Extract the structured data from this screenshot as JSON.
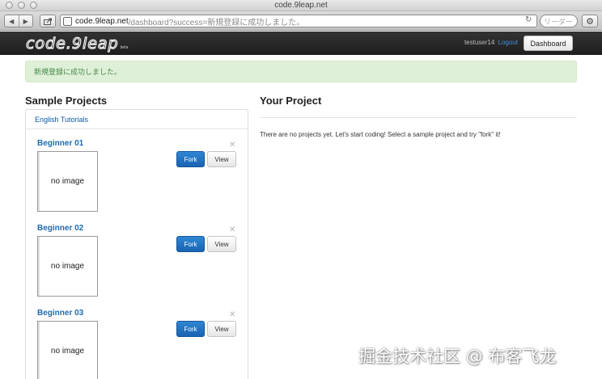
{
  "window": {
    "title": "code.9leap.net"
  },
  "toolbar": {
    "back_icon": "back-arrow-icon",
    "forward_icon": "forward-arrow-icon",
    "url_host": "code.9leap.net",
    "url_path": "/dashboard?success=新規登録に成功しました。",
    "search_placeholder": "リーダー"
  },
  "navbar": {
    "logo": "code.9leap",
    "logo_beta": "beta",
    "username": "testuser14",
    "logout_label": "Logout",
    "dashboard_label": "Dashboard"
  },
  "alert": {
    "message": "新規登録に成功しました。"
  },
  "sample": {
    "heading": "Sample Projects",
    "tab_label": "English Tutorials",
    "projects": [
      {
        "title": "Beginner 01",
        "thumb": "no image",
        "fork": "Fork",
        "view": "View"
      },
      {
        "title": "Beginner 02",
        "thumb": "no image",
        "fork": "Fork",
        "view": "View"
      },
      {
        "title": "Beginner 03",
        "thumb": "no image",
        "fork": "Fork",
        "view": "View"
      }
    ]
  },
  "project": {
    "heading": "Your Project",
    "message": "There are no projects yet. Let's start coding! Select a sample project and try \"fork\" it!"
  },
  "watermark": "掘金技术社区 @ 布客飞龙",
  "colors": {
    "navbar": "#222222",
    "link": "#1c6bb5",
    "fork_button": "#1f6fbd",
    "alert_bg": "#dff0d8",
    "alert_text": "#468847"
  }
}
